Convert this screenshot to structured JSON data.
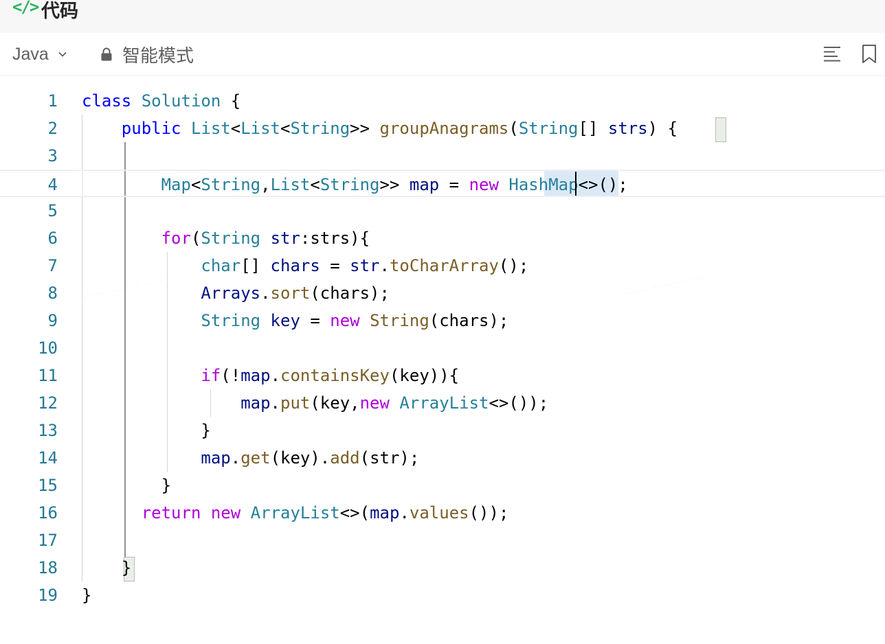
{
  "title": {
    "icon": "code-icon",
    "icon_glyph": "</>",
    "label": "代码",
    "accent_color": "#2db55d"
  },
  "toolbar": {
    "language": "Java",
    "mode_icon": "lock-icon",
    "mode_label": "智能模式",
    "format_icon": "format-lines-icon",
    "bookmark_icon": "bookmark-icon"
  },
  "editor": {
    "current_line": 4,
    "cursor": {
      "line": 4,
      "column": 30
    },
    "line_numbers": [
      "1",
      "2",
      "3",
      "4",
      "5",
      "6",
      "7",
      "8",
      "9",
      "10",
      "11",
      "12",
      "13",
      "14",
      "15",
      "16",
      "17",
      "18",
      "19"
    ],
    "lines": [
      [
        {
          "t": "class",
          "c": "kw"
        },
        {
          "t": " ",
          "c": "id"
        },
        {
          "t": "Solution",
          "c": "ty"
        },
        {
          "t": " {",
          "c": "id"
        }
      ],
      [
        {
          "t": "    ",
          "c": "id"
        },
        {
          "t": "public",
          "c": "kw"
        },
        {
          "t": " ",
          "c": "id"
        },
        {
          "t": "List",
          "c": "ty"
        },
        {
          "t": "<",
          "c": "id"
        },
        {
          "t": "List",
          "c": "ty"
        },
        {
          "t": "<",
          "c": "id"
        },
        {
          "t": "String",
          "c": "ty"
        },
        {
          "t": ">> ",
          "c": "id"
        },
        {
          "t": "groupAnagrams",
          "c": "fn"
        },
        {
          "t": "(",
          "c": "id"
        },
        {
          "t": "String",
          "c": "ty"
        },
        {
          "t": "[] ",
          "c": "id"
        },
        {
          "t": "strs",
          "c": "vr"
        },
        {
          "t": ") {",
          "c": "id"
        }
      ],
      [],
      [
        {
          "t": "        ",
          "c": "id"
        },
        {
          "t": "Map",
          "c": "ty"
        },
        {
          "t": "<",
          "c": "id"
        },
        {
          "t": "String",
          "c": "ty"
        },
        {
          "t": ",",
          "c": "id"
        },
        {
          "t": "List",
          "c": "ty"
        },
        {
          "t": "<",
          "c": "id"
        },
        {
          "t": "String",
          "c": "ty"
        },
        {
          "t": ">> ",
          "c": "id"
        },
        {
          "t": "map",
          "c": "vr"
        },
        {
          "t": " = ",
          "c": "id"
        },
        {
          "t": "new",
          "c": "kc"
        },
        {
          "t": " ",
          "c": "id"
        },
        {
          "t": "HashMap",
          "c": "ty"
        },
        {
          "t": "<>();",
          "c": "id"
        }
      ],
      [],
      [
        {
          "t": "        ",
          "c": "id"
        },
        {
          "t": "for",
          "c": "kc"
        },
        {
          "t": "(",
          "c": "id"
        },
        {
          "t": "String",
          "c": "ty"
        },
        {
          "t": " ",
          "c": "id"
        },
        {
          "t": "str",
          "c": "vr"
        },
        {
          "t": ":",
          "c": "id"
        },
        {
          "t": "strs",
          "c": "id"
        },
        {
          "t": "){",
          "c": "id"
        }
      ],
      [
        {
          "t": "            ",
          "c": "id"
        },
        {
          "t": "char",
          "c": "ty"
        },
        {
          "t": "[] ",
          "c": "id"
        },
        {
          "t": "chars",
          "c": "vr"
        },
        {
          "t": " = ",
          "c": "id"
        },
        {
          "t": "str",
          "c": "vr"
        },
        {
          "t": ".",
          "c": "id"
        },
        {
          "t": "toCharArray",
          "c": "fn"
        },
        {
          "t": "();",
          "c": "id"
        }
      ],
      [
        {
          "t": "            ",
          "c": "id"
        },
        {
          "t": "Arrays",
          "c": "vr"
        },
        {
          "t": ".",
          "c": "id"
        },
        {
          "t": "sort",
          "c": "fn"
        },
        {
          "t": "(chars);",
          "c": "id"
        }
      ],
      [
        {
          "t": "            ",
          "c": "id"
        },
        {
          "t": "String",
          "c": "ty"
        },
        {
          "t": " ",
          "c": "id"
        },
        {
          "t": "key",
          "c": "vr"
        },
        {
          "t": " = ",
          "c": "id"
        },
        {
          "t": "new",
          "c": "kc"
        },
        {
          "t": " ",
          "c": "id"
        },
        {
          "t": "String",
          "c": "fn"
        },
        {
          "t": "(chars);",
          "c": "id"
        }
      ],
      [],
      [
        {
          "t": "            ",
          "c": "id"
        },
        {
          "t": "if",
          "c": "kc"
        },
        {
          "t": "(!",
          "c": "id"
        },
        {
          "t": "map",
          "c": "vr"
        },
        {
          "t": ".",
          "c": "id"
        },
        {
          "t": "containsKey",
          "c": "fn"
        },
        {
          "t": "(key)){",
          "c": "id"
        }
      ],
      [
        {
          "t": "                ",
          "c": "id"
        },
        {
          "t": "map",
          "c": "vr"
        },
        {
          "t": ".",
          "c": "id"
        },
        {
          "t": "put",
          "c": "fn"
        },
        {
          "t": "(key,",
          "c": "id"
        },
        {
          "t": "new",
          "c": "kc"
        },
        {
          "t": " ",
          "c": "id"
        },
        {
          "t": "ArrayList",
          "c": "ty"
        },
        {
          "t": "<>());",
          "c": "id"
        }
      ],
      [
        {
          "t": "            }",
          "c": "id"
        }
      ],
      [
        {
          "t": "            ",
          "c": "id"
        },
        {
          "t": "map",
          "c": "vr"
        },
        {
          "t": ".",
          "c": "id"
        },
        {
          "t": "get",
          "c": "fn"
        },
        {
          "t": "(key).",
          "c": "id"
        },
        {
          "t": "add",
          "c": "fn"
        },
        {
          "t": "(str);",
          "c": "id"
        }
      ],
      [
        {
          "t": "        }",
          "c": "id"
        }
      ],
      [
        {
          "t": "      ",
          "c": "id"
        },
        {
          "t": "return",
          "c": "kc"
        },
        {
          "t": " ",
          "c": "id"
        },
        {
          "t": "new",
          "c": "kc"
        },
        {
          "t": " ",
          "c": "id"
        },
        {
          "t": "ArrayList",
          "c": "ty"
        },
        {
          "t": "<>(",
          "c": "id"
        },
        {
          "t": "map",
          "c": "vr"
        },
        {
          "t": ".",
          "c": "id"
        },
        {
          "t": "values",
          "c": "fn"
        },
        {
          "t": "());",
          "c": "id"
        }
      ],
      [],
      [
        {
          "t": "    }",
          "c": "id"
        }
      ],
      [
        {
          "t": "}",
          "c": "id"
        }
      ]
    ]
  }
}
